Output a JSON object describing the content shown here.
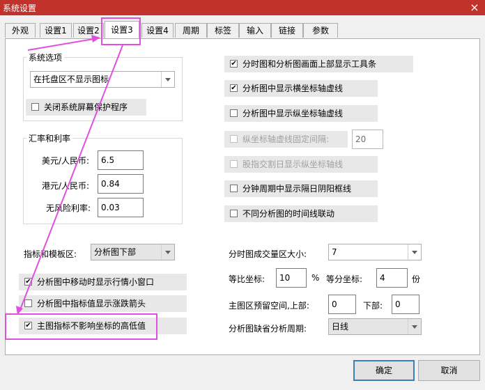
{
  "window": {
    "title": "系统设置",
    "close_icon": "×"
  },
  "tabs": [
    "外观",
    "设置1",
    "设置2",
    "设置3",
    "设置4",
    "周期",
    "标签",
    "输入",
    "链接",
    "参数"
  ],
  "active_tab": "设置3",
  "system_options": {
    "label": "系统选项",
    "tray_value": "在托盘区不显示图标",
    "screensaver_label": "关闭系统屏幕保护程序"
  },
  "exchange": {
    "label": "汇率和利率",
    "usd_label": "美元/人民币:",
    "usd_value": "6.5",
    "hkd_label": "港元/人民币:",
    "hkd_value": "0.84",
    "riskfree_label": "无风险利率:",
    "riskfree_value": "0.03"
  },
  "indicator_area": {
    "label": "指标和模板区:",
    "value": "分析图下部"
  },
  "left_checks": [
    {
      "label": "分析图中移动时显示行情小窗口",
      "checked": true
    },
    {
      "label": "分析图中指标值显示涨跌箭头",
      "checked": false
    },
    {
      "label": "主图指标不影响坐标的高低值",
      "checked": true
    }
  ],
  "right_checks": [
    {
      "label": "分时图和分析图画面上部显示工具条",
      "checked": true
    },
    {
      "label": "分析图中显示横坐标轴虚线",
      "checked": true
    },
    {
      "label": "分析图中显示纵坐标轴虚线",
      "checked": false
    },
    {
      "label": "纵坐标轴虚线固定间隔:",
      "checked": false,
      "disabled": true
    },
    {
      "label": "股指交割日显示纵坐标轴线",
      "checked": false,
      "disabled": true
    },
    {
      "label": "分钟周期中显示隔日阴阳框线",
      "checked": false
    },
    {
      "label": "不同分析图的时间线联动",
      "checked": false
    }
  ],
  "fixed_interval_value": "20",
  "volume_area": {
    "label": "分时图成交量区大小:",
    "value": "7"
  },
  "scale": {
    "ratio_label": "等比坐标:",
    "ratio_value": "10",
    "ratio_unit": "%",
    "equal_label": "等分坐标:",
    "equal_value": "4",
    "equal_unit": "份"
  },
  "reserve": {
    "label": "主图区预留空间,上部:",
    "top_value": "0",
    "bottom_label": "下部:",
    "bottom_value": "0"
  },
  "default_period": {
    "label": "分析图缺省分析周期:",
    "value": "日线"
  },
  "buttons": {
    "ok": "确定",
    "cancel": "取消"
  },
  "check_mark": "✔",
  "annotation_color": "#e04fe0"
}
